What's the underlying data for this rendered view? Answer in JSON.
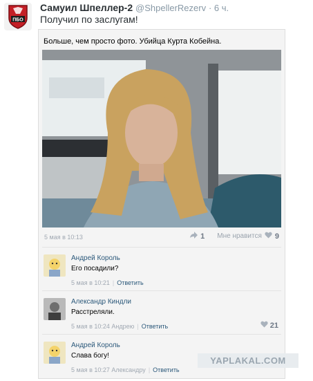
{
  "tweet": {
    "name": "Самуил Шпеллер-2",
    "handle": "@ShpellerRezerv",
    "time": "· 6 ч.",
    "text": "Получил по заслугам!",
    "avatar_icon": "shield-logo-icon",
    "avatar_logo_text": "ПБО"
  },
  "post": {
    "text": "Больше, чем просто фото. Убийца Курта Кобейна.",
    "date": "5 мая в 10:13",
    "reposts": "1",
    "likes_label": "Мне нравится",
    "likes": "9"
  },
  "comments": [
    {
      "author": "Андрей Король",
      "text": "Его посадили?",
      "date": "5 мая в 10:21",
      "reply_label": "Ответить"
    },
    {
      "author": "Александр Киндли",
      "text": "Расстреляли.",
      "date": "5 мая в 10:24 Андрею",
      "reply_label": "Ответить",
      "likes": "21"
    },
    {
      "author": "Андрей Король",
      "text": "Слава богу!",
      "date": "5 мая в 10:27 Александру",
      "reply_label": "Ответить"
    }
  ],
  "watermark": "YAPLAKAL.COM",
  "colors": {
    "link": "#2b587a",
    "muted": "#a0a8b2",
    "card_bg": "#f4f4f4",
    "brand_red": "#c41f26"
  }
}
